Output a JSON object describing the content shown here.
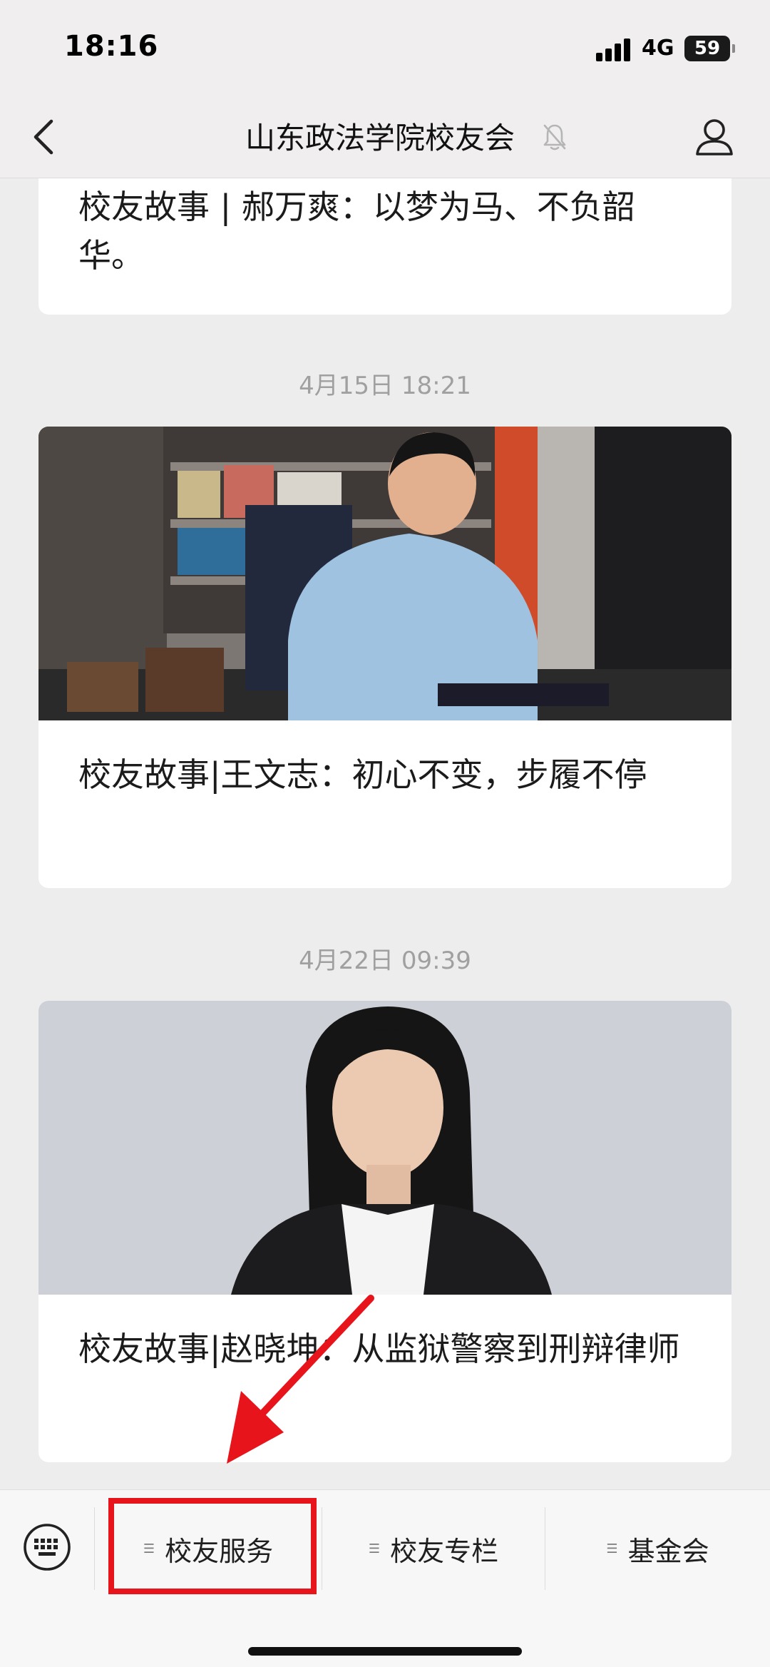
{
  "status_bar": {
    "time": "18:16",
    "network": "4G",
    "battery": "59"
  },
  "nav": {
    "title": "山东政法学院校友会"
  },
  "feed": {
    "items": [
      {
        "title": "校友故事 | 郝万爽：以梦为马、不负韶华。"
      },
      {
        "timestamp": "4月15日 18:21",
        "title": "校友故事|王文志：初心不变，步履不停"
      },
      {
        "timestamp": "4月22日 09:39",
        "title": "校友故事|赵晓坤：从监狱警察到刑辩律师"
      }
    ]
  },
  "menu": {
    "items": [
      {
        "label": "校友服务"
      },
      {
        "label": "校友专栏"
      },
      {
        "label": "基金会"
      }
    ]
  },
  "colors": {
    "annotation": "#e8141b",
    "background": "#ededed"
  }
}
